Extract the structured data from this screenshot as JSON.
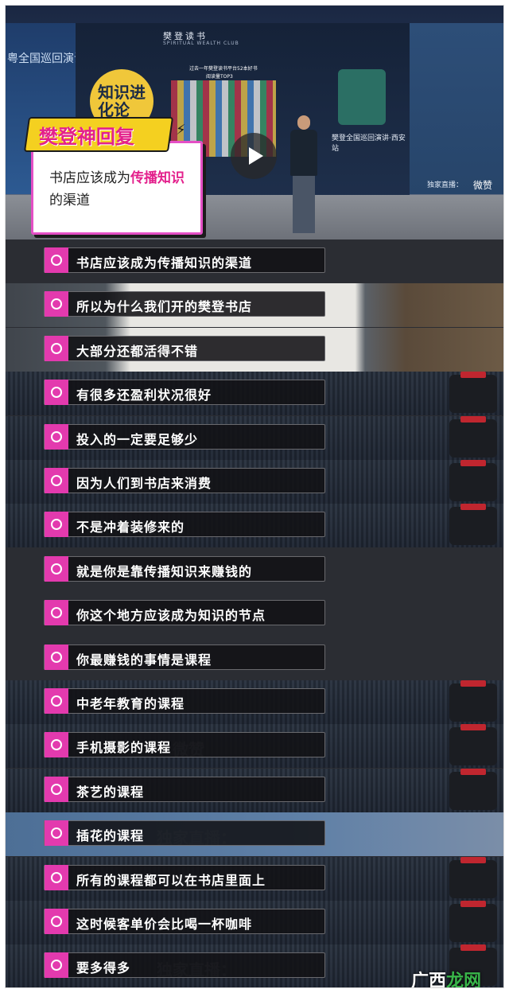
{
  "video": {
    "left_banner_text": "粤全国巡回演讲",
    "screen_brand": "樊登读书",
    "screen_brand_sub": "SPIRITUAL WEALTH CLUB",
    "screen_headline": "过去一年樊登读书平台52本好书",
    "screen_headline_2": "阅读量TOP3",
    "book_logo_text": "知识进化论",
    "screen_caption": "樊登全国巡回演讲·西安站",
    "right_banner_live": "独家直播：",
    "right_banner_brand": "微赞",
    "play_icon": "play-icon"
  },
  "card": {
    "badge": "樊登神回复",
    "text_before": "书店应该成为",
    "text_highlight": "传播知识",
    "text_after": "的渠道"
  },
  "subtitles": [
    "书店应该成为传播知识的渠道",
    "所以为什么我们开的樊登书店",
    "大部分还都活得不错",
    "有很多还盈利状况很好",
    "投入的一定要足够少",
    "因为人们到书店来消费",
    "不是冲着装修来的",
    "就是你是靠传播知识来赚钱的",
    "你这个地方应该成为知识的节点",
    "你最赚钱的事情是课程",
    "中老年教育的课程",
    "手机摄影的课程",
    "茶艺的课程",
    "插花的课程",
    "所有的课程都可以在书店里面上",
    "这时候客单价会比喝一杯咖啡",
    "要多得多"
  ],
  "watermarks": [
    "微赞直播",
    "微赞",
    "独家直播：",
    "微"
  ],
  "site_mark": {
    "prefix": "广西",
    "suffix": "龙网"
  },
  "colors": {
    "accent_pink": "#e33aae",
    "highlight_pink": "#e3208c",
    "badge_yellow": "#f4d020"
  }
}
